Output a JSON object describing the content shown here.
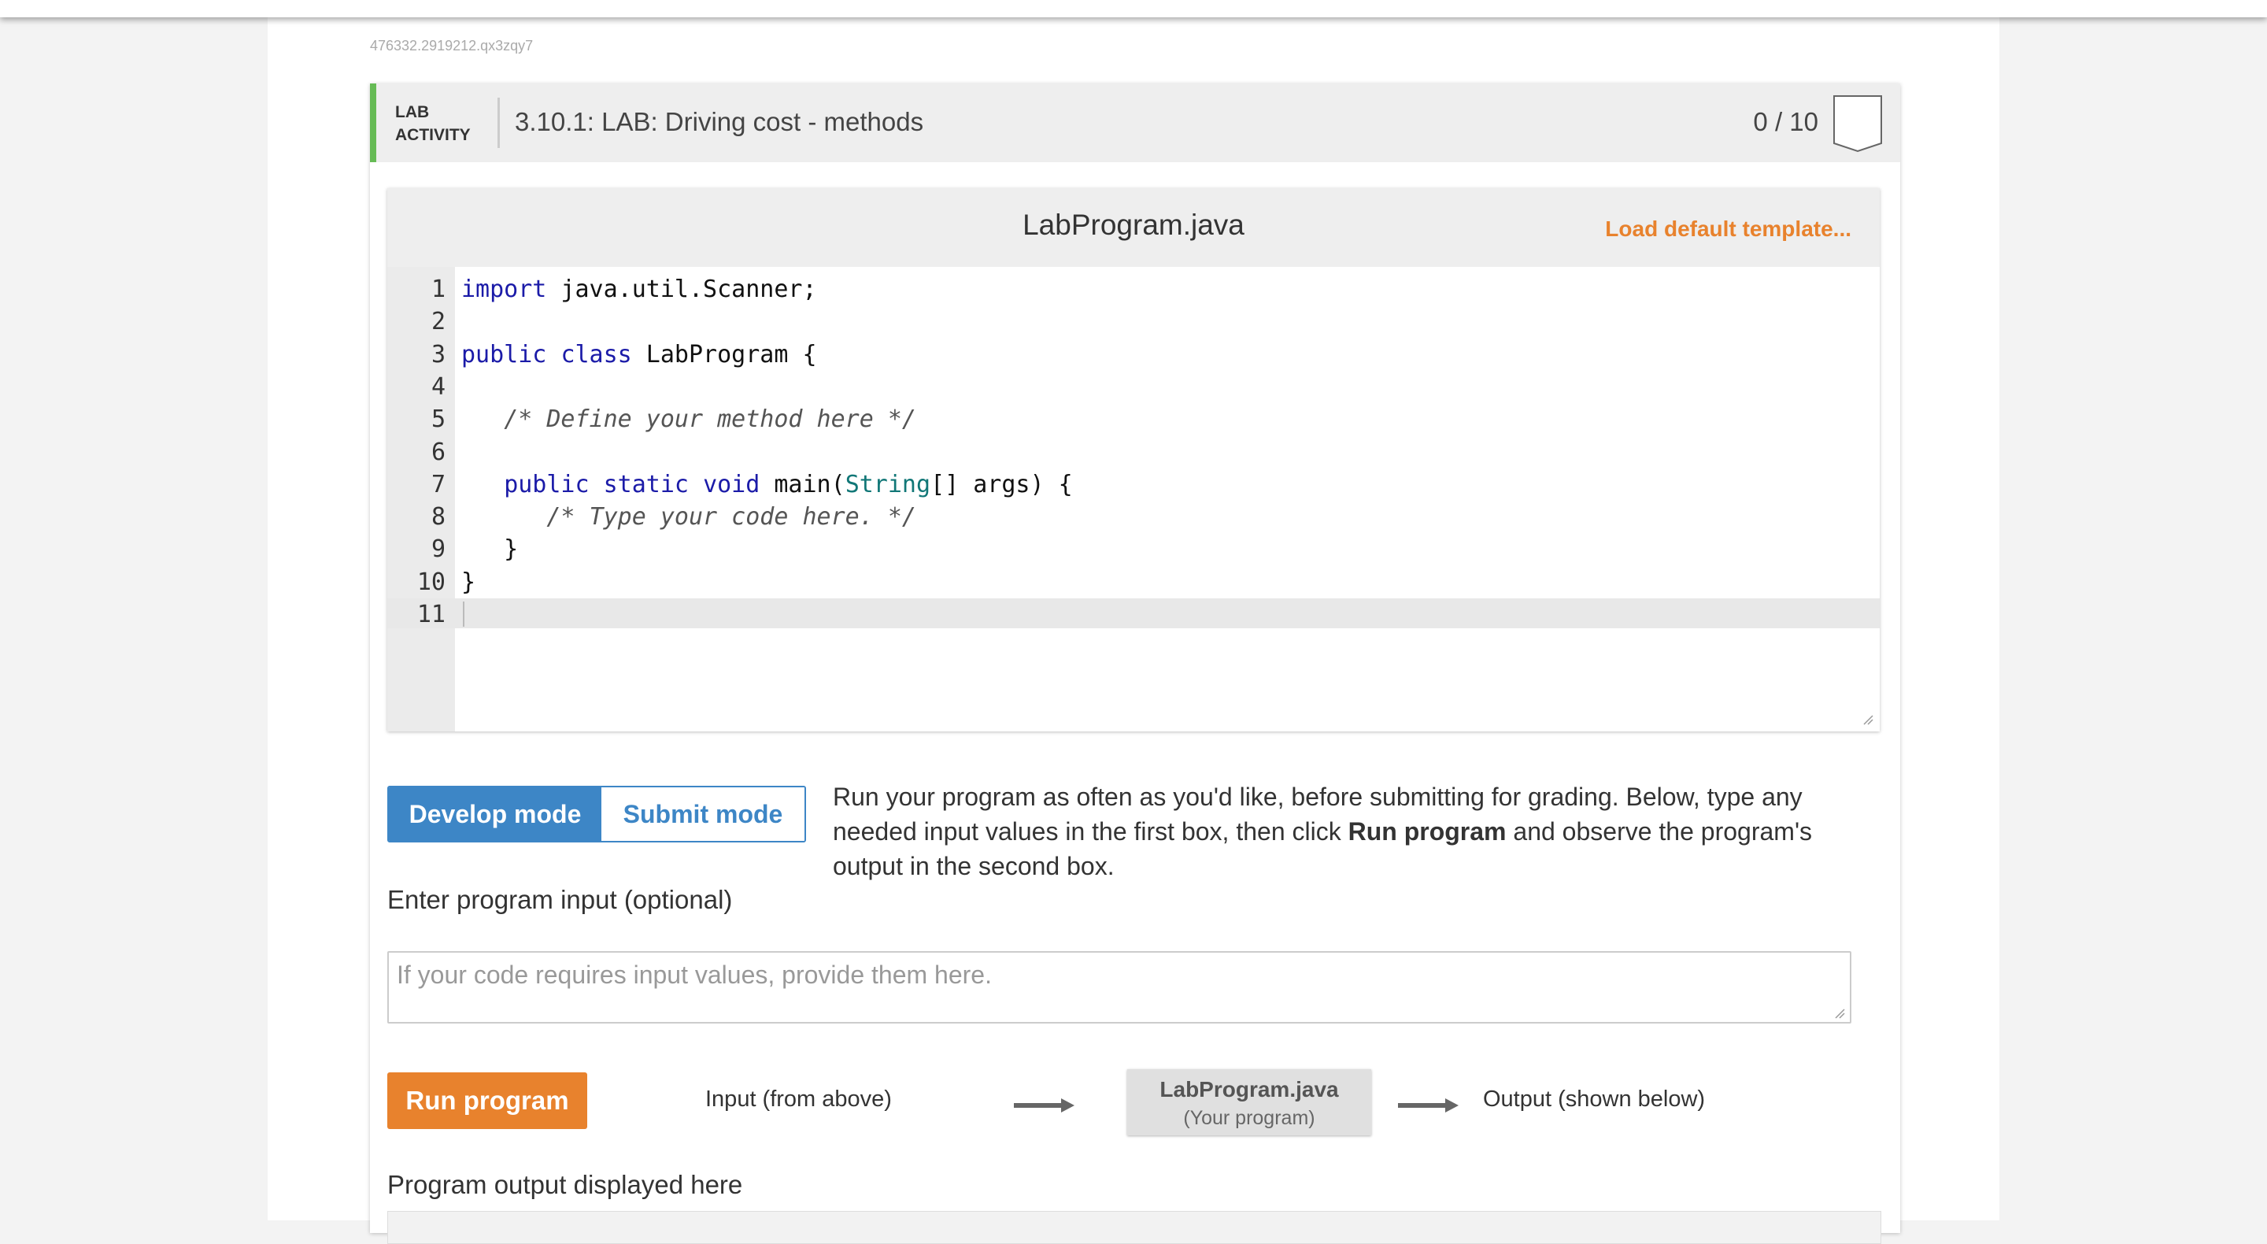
{
  "activity_id": "476332.2919212.qx3zqy7",
  "header": {
    "lab_label_line1": "LAB",
    "lab_label_line2": "ACTIVITY",
    "title": "3.10.1: LAB: Driving cost - methods",
    "score": "0 / 10"
  },
  "editor": {
    "file_name": "LabProgram.java",
    "load_template_label": "Load default template...",
    "line_numbers": [
      "1",
      "2",
      "3",
      "4",
      "5",
      "6",
      "7",
      "8",
      "9",
      "10",
      "11"
    ],
    "lines": [
      "import java.util.Scanner;",
      "",
      "public class LabProgram {",
      "",
      "   /* Define your method here */",
      "",
      "   public static void main(String[] args) {",
      "      /* Type your code here. */",
      "   }",
      "}",
      ""
    ]
  },
  "modes": {
    "develop_label": "Develop mode",
    "submit_label": "Submit mode",
    "active": "develop",
    "description_pre": "Run your program as often as you'd like, before submitting for grading. Below, type any needed input values in the first box, then click ",
    "description_bold": "Run program",
    "description_post": " and observe the program's output in the second box."
  },
  "input": {
    "label": "Enter program input (optional)",
    "placeholder": "If your code requires input values, provide them here."
  },
  "run": {
    "button_label": "Run program",
    "flow_input": "Input (from above)",
    "program_name": "LabProgram.java",
    "program_sub": "(Your program)",
    "flow_output": "Output (shown below)"
  },
  "output": {
    "label": "Program output displayed here"
  },
  "colors": {
    "accent_green": "#66bb55",
    "mode_blue": "#3d86c6",
    "run_orange": "#e8822d",
    "keyword": "#1b1ba8",
    "type": "#117777"
  },
  "icons": {
    "badge": "completion-badge-icon",
    "arrow": "right-arrow-icon",
    "resize": "resize-handle-icon"
  }
}
